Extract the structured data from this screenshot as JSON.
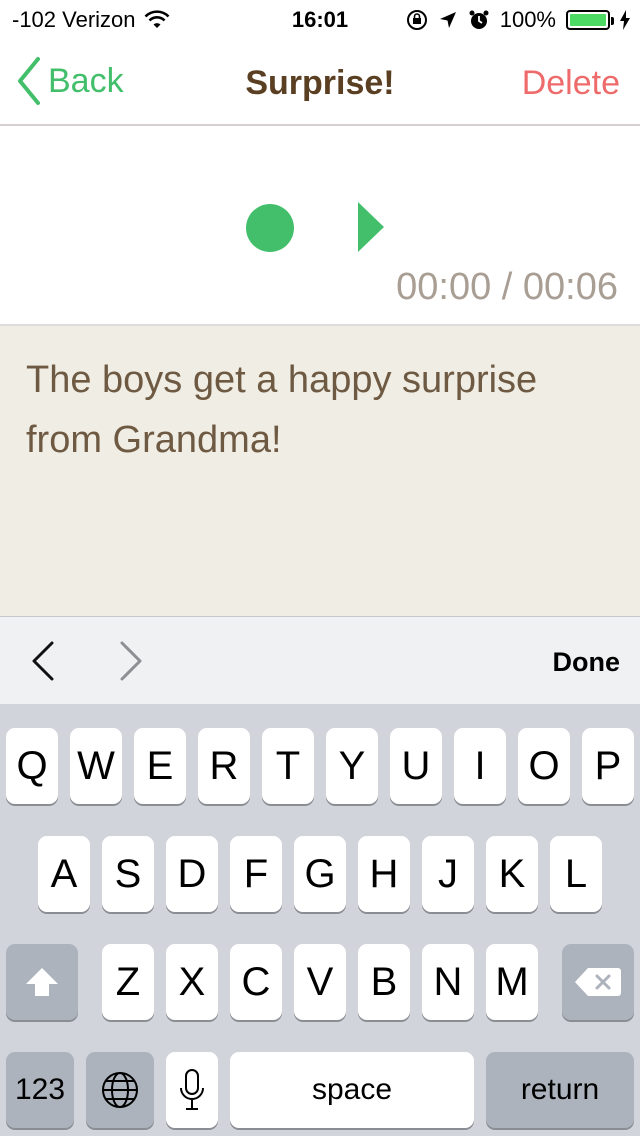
{
  "status_bar": {
    "carrier": "-102 Verizon",
    "time": "16:01",
    "battery_percent": "100%",
    "battery_level": 1.0
  },
  "nav": {
    "back_label": "Back",
    "title": "Surprise!",
    "delete_label": "Delete"
  },
  "player": {
    "time_readout": "00:00 / 00:06"
  },
  "caption": {
    "text": "The boys get a happy surprise from Grandma!"
  },
  "accessory": {
    "done_label": "Done"
  },
  "keyboard": {
    "row1": [
      "Q",
      "W",
      "E",
      "R",
      "T",
      "Y",
      "U",
      "I",
      "O",
      "P"
    ],
    "row2": [
      "A",
      "S",
      "D",
      "F",
      "G",
      "H",
      "J",
      "K",
      "L"
    ],
    "row3": [
      "Z",
      "X",
      "C",
      "V",
      "B",
      "N",
      "M"
    ],
    "numbers_label": "123",
    "space_label": "space",
    "return_label": "return"
  },
  "colors": {
    "accent_green": "#43bf6b",
    "delete_red": "#ef6b6b",
    "title_brown": "#5a3f22",
    "caption_bg": "#f0ede4"
  }
}
